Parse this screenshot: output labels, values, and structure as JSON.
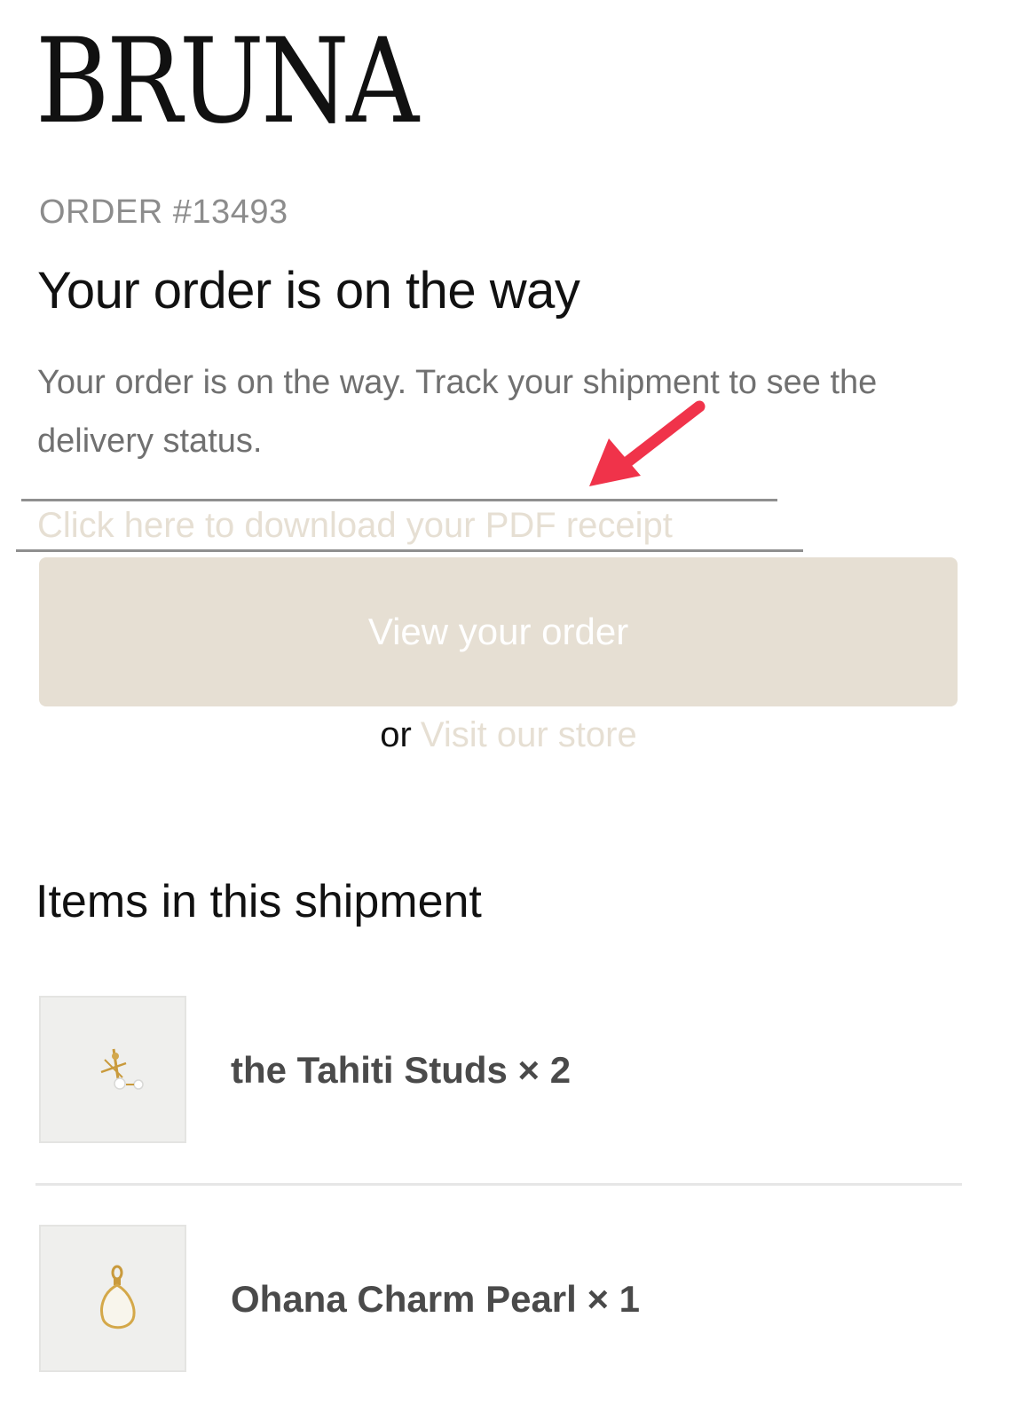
{
  "brand": {
    "logo_text": "BRUNA"
  },
  "order": {
    "number_label": "ORDER #13493",
    "headline": "Your order is on the way",
    "message": "Your order is on the way. Track your shipment to see the delivery status.",
    "pdf_link_label": "Click here to download your PDF receipt",
    "view_button_label": "View your order",
    "or_text": "or",
    "store_link_label": "Visit our store"
  },
  "shipment": {
    "heading": "Items in this shipment",
    "items": [
      {
        "label": "the Tahiti Studs × 2",
        "thumbnail_icon": "stud-earring-icon"
      },
      {
        "label": "Ohana Charm Pearl × 1",
        "thumbnail_icon": "pearl-charm-icon"
      }
    ]
  },
  "annotation": {
    "arrow_color": "#f0334a",
    "arrow_icon": "arrow-annotation-icon"
  },
  "colors": {
    "accent_beige": "#e6dfd3",
    "muted_text": "#707070",
    "item_text": "#4a4a4a"
  }
}
